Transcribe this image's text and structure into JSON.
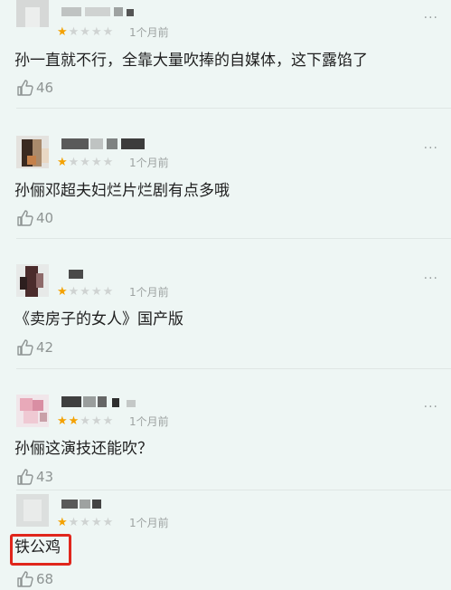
{
  "reviews": [
    {
      "rating": 1,
      "stars_on": "★",
      "stars_off": "★★★★",
      "time": "1个月前",
      "more": "···",
      "content": "孙一直就不行，全靠大量吹捧的自媒体，这下露馅了",
      "likes": "46"
    },
    {
      "rating": 1,
      "stars_on": "★",
      "stars_off": "★★★★",
      "time": "1个月前",
      "more": "···",
      "content": "孙俪邓超夫妇烂片烂剧有点多哦",
      "likes": "40"
    },
    {
      "rating": 1,
      "stars_on": "★",
      "stars_off": "★★★★",
      "time": "1个月前",
      "more": "···",
      "content": "《卖房子的女人》国产版",
      "likes": "42"
    },
    {
      "rating": 2,
      "stars_on": "★★",
      "stars_off": "★★★",
      "time": "1个月前",
      "more": "···",
      "content": "孙俪这演技还能吹？",
      "likes": "43"
    },
    {
      "rating": 1,
      "stars_on": "★",
      "stars_off": "★★★★",
      "time": "1个月前",
      "more": "···",
      "content": "铁公鸡",
      "likes": "68"
    }
  ],
  "colors": {
    "background": "#eef6f4",
    "star_active": "#f4a100",
    "star_inactive": "#cfd3d2",
    "highlight_box": "#e0261c",
    "meta_text": "#9ea3a2"
  },
  "icons": {
    "like": "thumbs-up-icon",
    "more": "more-dots-icon"
  }
}
